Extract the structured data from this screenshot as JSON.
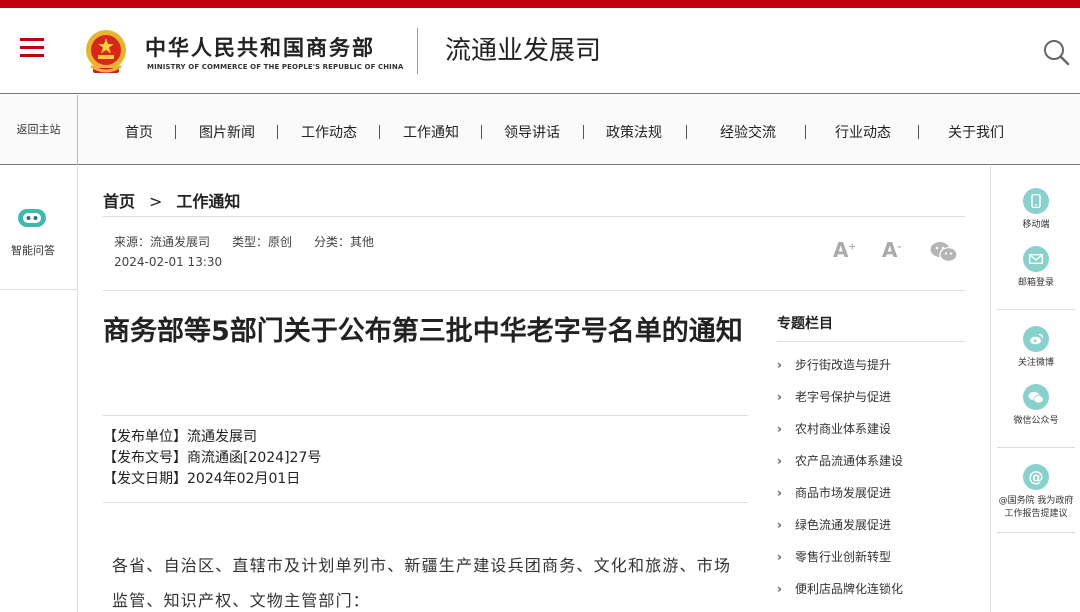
{
  "header": {
    "ministry_cn": "中华人民共和国商务部",
    "ministry_en": "MINISTRY OF COMMERCE OF THE PEOPLE'S REPUBLIC OF CHINA",
    "department": "流通业发展司",
    "accent_color": "#c0000b"
  },
  "nav": {
    "back_home": "返回主站",
    "items": [
      "首页",
      "图片新闻",
      "工作动态",
      "工作通知",
      "领导讲话",
      "政策法规",
      "经验交流",
      "行业动态",
      "关于我们"
    ]
  },
  "left_sidebar": {
    "ai_label": "智能问答"
  },
  "right_sidebar": {
    "mobile": "移动端",
    "mail": "邮箱登录",
    "weibo": "关注微博",
    "wechat": "微信公众号",
    "suggest_line1": "@国务院 我为政府",
    "suggest_line2": "工作报告提建议"
  },
  "breadcrumb": {
    "home": "首页",
    "sep": ">",
    "current": "工作通知"
  },
  "meta": {
    "source": "来源：流通发展司",
    "type": "类型：原创",
    "category": "分类：其他",
    "datetime": "2024-02-01 13:30"
  },
  "tools": {
    "font_larger": "A",
    "font_smaller": "A"
  },
  "article": {
    "title": "商务部等5部门关于公布第三批中华老字号名单的通知",
    "publisher": "【发布单位】流通发展司",
    "doc_number": "【发布文号】商流通函[2024]27号",
    "pub_date": "【发文日期】2024年02月01日",
    "body_start": "各省、自治区、直辖市及计划单列市、新疆生产建设兵团商务、文化和旅游、市场监管、知识产权、文物主管部门："
  },
  "topics": {
    "title": "专题栏目",
    "items": [
      "步行街改造与提升",
      "老字号保护与促进",
      "农村商业体系建设",
      "农产品流通体系建设",
      "商品市场发展促进",
      "绿色流通发展促进",
      "零售行业创新转型",
      "便利店品牌化连锁化"
    ]
  }
}
